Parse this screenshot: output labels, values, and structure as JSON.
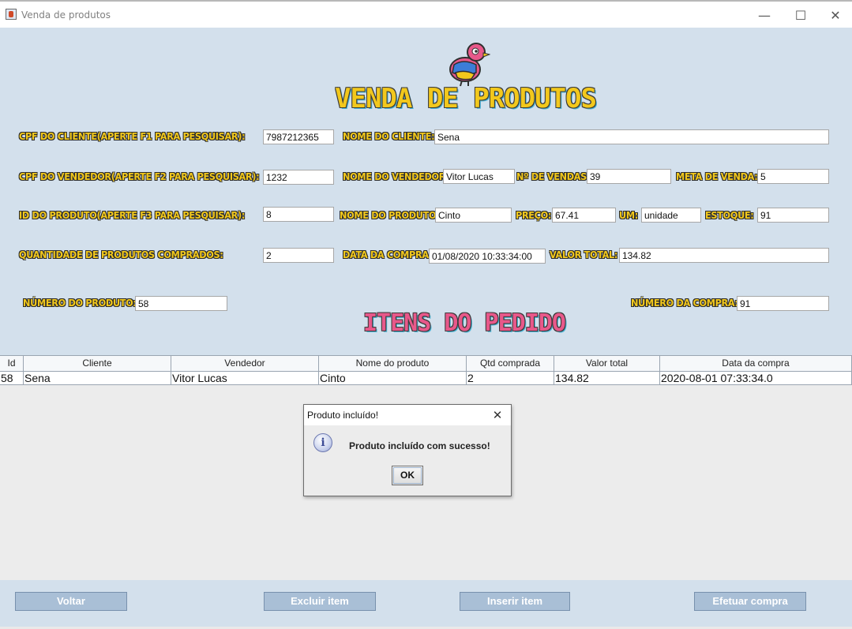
{
  "window": {
    "title": "Venda de produtos",
    "minimize": "—",
    "maximize": "☐",
    "close": "✕"
  },
  "header": {
    "title": "VENDA DE PRODUTOS",
    "section_title": "ITENS DO PEDIDO"
  },
  "form": {
    "cpf_cliente_label": "CPF DO CLIENTE(APERTE F1 PARA PESQUISAR):",
    "cpf_cliente": "7987212365",
    "nome_cliente_label": "NOME DO CLIENTE:",
    "nome_cliente": "Sena",
    "cpf_vendedor_label": "CPF DO VENDEDOR(APERTE F2 PARA PESQUISAR):",
    "cpf_vendedor": "1232",
    "nome_vendedor_label": "NOME DO VENDEDOR:",
    "nome_vendedor": "Vitor Lucas",
    "n_vendas_label": "Nº DE VENDAS:",
    "n_vendas": "39",
    "meta_label": "META DE VENDA:",
    "meta": "5",
    "id_produto_label": "ID DO PRODUTO(APERTE F3 PARA PESQUISAR):",
    "id_produto": "8",
    "nome_produto_label": "NOME DO PRODUTO:",
    "nome_produto": "Cinto",
    "preco_label": "PREÇO:",
    "preco": "67.41",
    "um_label": "UM:",
    "um": "unidade",
    "estoque_label": "ESTOQUE:",
    "estoque": "91",
    "quantidade_label": "QUANTIDADE DE PRODUTOS COMPRADOS:",
    "quantidade": "2",
    "data_compra_label": "DATA DA COMPRA:",
    "data_compra": "01/08/2020 10:33:34:00",
    "valor_total_label": "VALOR TOTAL:",
    "valor_total": "134.82",
    "numero_produto_label": "NÚMERO DO PRODUTO:",
    "numero_produto": "58",
    "numero_compra_label": "NÚMERO DA COMPRA:",
    "numero_compra": "91"
  },
  "table": {
    "columns": [
      "Id",
      "Cliente",
      "Vendedor",
      "Nome do produto",
      "Qtd comprada",
      "Valor total",
      "Data da compra"
    ],
    "rows": [
      [
        "58",
        "Sena",
        "Vitor Lucas",
        "Cinto",
        "2",
        "134.82",
        "2020-08-01 07:33:34.0"
      ]
    ]
  },
  "dialog": {
    "title": "Produto incluído!",
    "message": "Produto incluído com sucesso!",
    "ok": "OK",
    "close": "✕",
    "icon": "i"
  },
  "buttons": {
    "voltar": "Voltar",
    "excluir": "Excluir item",
    "inserir": "Inserir item",
    "efetuar": "Efetuar compra"
  }
}
